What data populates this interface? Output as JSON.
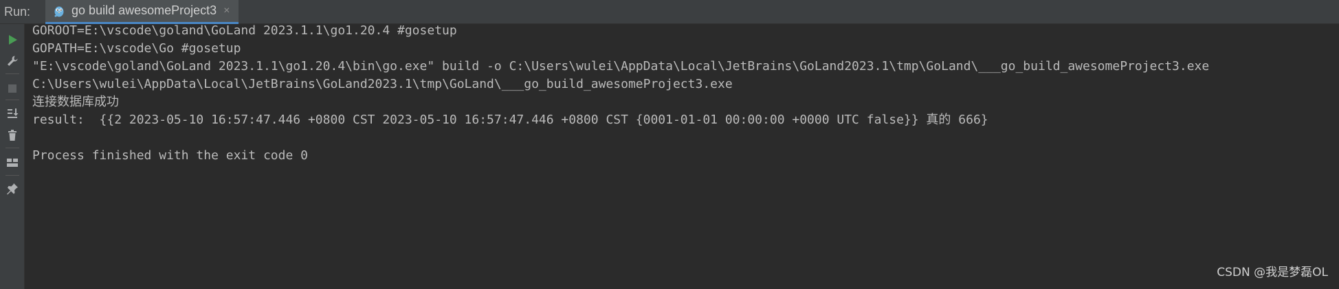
{
  "tabbar": {
    "run_label": "Run:",
    "tab_title": "go build awesomeProject3",
    "tab_icon": "go-gopher-icon",
    "close_glyph": "×"
  },
  "toolbar": {
    "buttons": [
      "run-icon",
      "wrench-icon",
      "stop-icon",
      "scroll-to-end-icon",
      "trash-icon",
      "layout-icon",
      "pin-icon"
    ]
  },
  "console": {
    "lines": [
      "GOROOT=E:\\vscode\\goland\\GoLand 2023.1.1\\go1.20.4 #gosetup",
      "GOPATH=E:\\vscode\\Go #gosetup",
      "\"E:\\vscode\\goland\\GoLand 2023.1.1\\go1.20.4\\bin\\go.exe\" build -o C:\\Users\\wulei\\AppData\\Local\\JetBrains\\GoLand2023.1\\tmp\\GoLand\\___go_build_awesomeProject3.exe",
      "C:\\Users\\wulei\\AppData\\Local\\JetBrains\\GoLand2023.1\\tmp\\GoLand\\___go_build_awesomeProject3.exe",
      "连接数据库成功",
      "result:  {{2 2023-05-10 16:57:47.446 +0800 CST 2023-05-10 16:57:47.446 +0800 CST {0001-01-01 00:00:00 +0000 UTC false}} 真的 666}",
      "",
      "Process finished with the exit code 0"
    ]
  },
  "watermark": "CSDN @我是梦磊OL",
  "colors": {
    "background": "#2b2b2b",
    "toolbar": "#3c3f41",
    "text": "#bbbbbb",
    "run_green": "#499c54",
    "tab_accent": "#4a88c7"
  }
}
